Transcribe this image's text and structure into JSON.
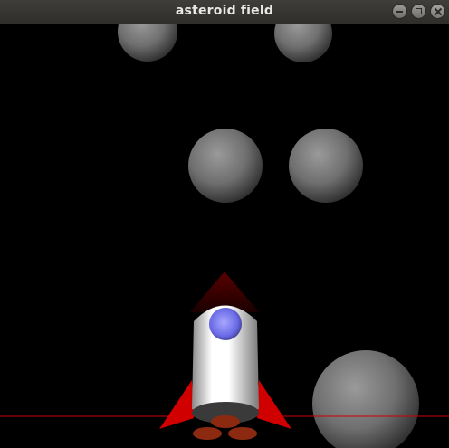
{
  "window": {
    "title": "asteroid field",
    "controls": [
      "minimize",
      "maximize",
      "close"
    ]
  },
  "scene": {
    "background_color": "#000000",
    "vertical_axis_color": "#00ff00",
    "horizontal_axis_color": "#cc0000",
    "asteroid_color": "#8c8c8c",
    "ship_body_color": "#ffffff",
    "ship_fin_color": "#d00000",
    "ship_window_color": "#7070ff",
    "ship_thruster_color": "#8b2a10"
  }
}
